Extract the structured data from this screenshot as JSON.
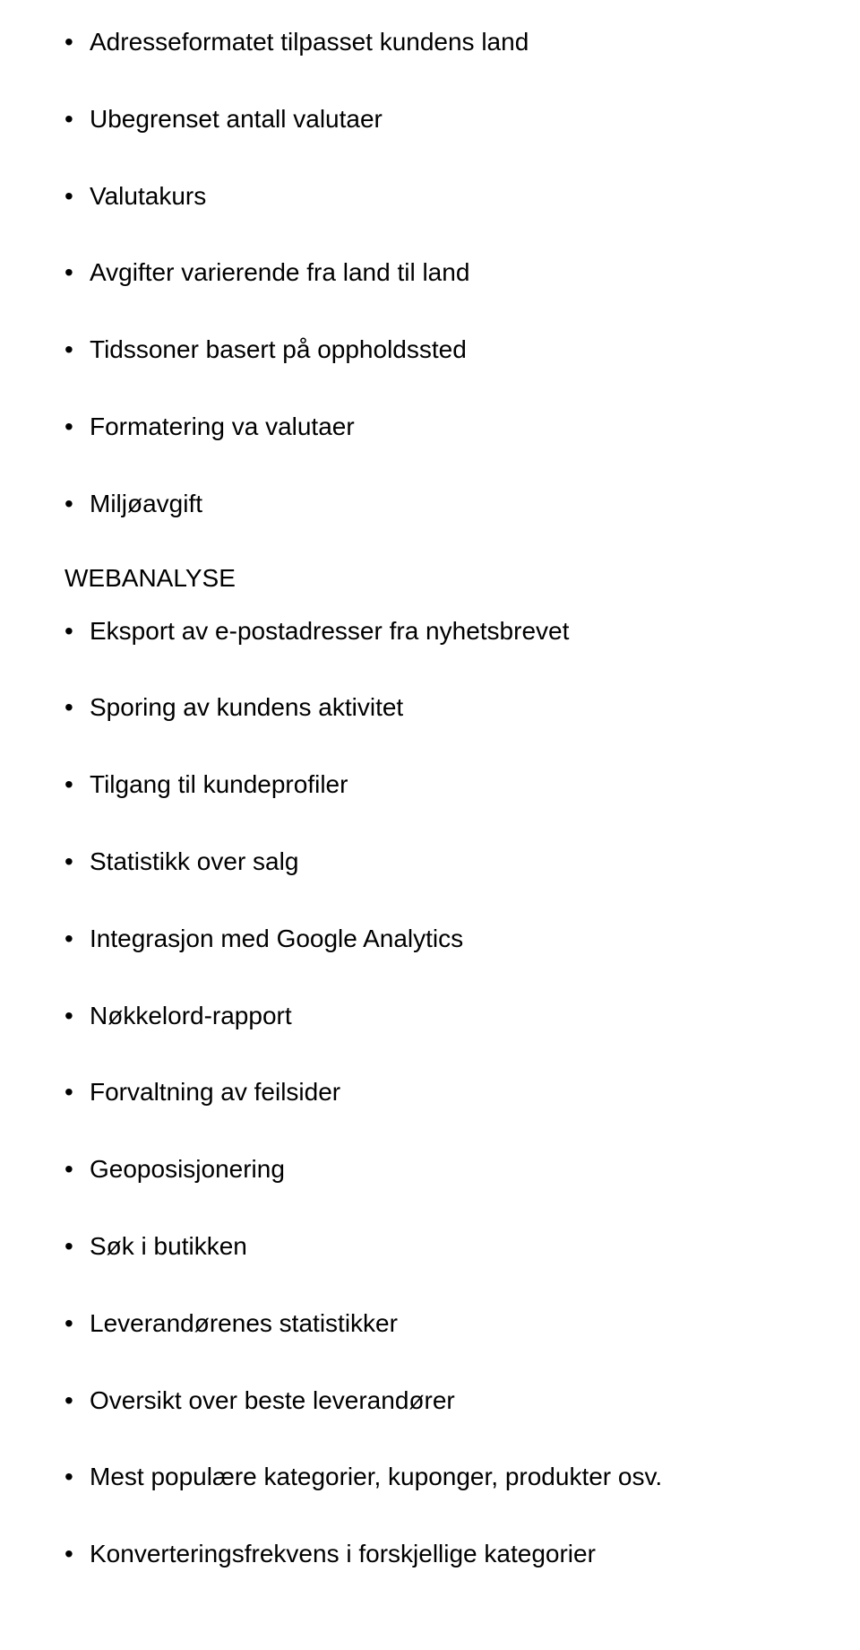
{
  "sections": [
    {
      "heading": null,
      "items": [
        "Adresseformatet tilpasset kundens land",
        "Ubegrenset antall valutaer",
        "Valutakurs",
        "Avgifter varierende fra land til land",
        "Tidssoner basert på oppholdssted",
        "Formatering va valutaer",
        "Miljøavgift"
      ]
    },
    {
      "heading": "WEBANALYSE",
      "items": [
        "Eksport av e-postadresser fra nyhetsbrevet",
        "Sporing av kundens aktivitet",
        "Tilgang til kundeprofiler",
        "Statistikk over salg",
        "Integrasjon med Google Analytics",
        "Nøkkelord-rapport",
        "Forvaltning av feilsider",
        "Geoposisjonering",
        "Søk i butikken",
        "Leverandørenes statistikker",
        "Oversikt over beste leverandører",
        "Mest populære kategorier, kuponger, produkter osv.",
        "Konverteringsfrekvens i forskjellige kategorier"
      ]
    }
  ]
}
